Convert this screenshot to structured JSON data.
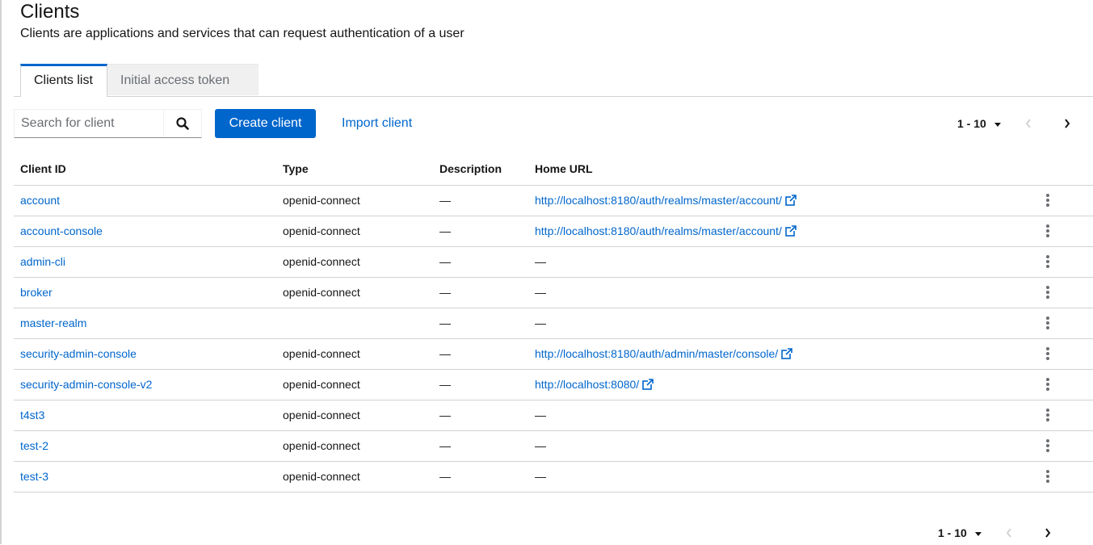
{
  "page": {
    "title": "Clients",
    "subtitle": "Clients are applications and services that can request authentication of a user"
  },
  "tabs": [
    {
      "label": "Clients list"
    },
    {
      "label": "Initial access token"
    }
  ],
  "toolbar": {
    "search_placeholder": "Search for client",
    "create_label": "Create client",
    "import_label": "Import client",
    "pagination": "1 - 10"
  },
  "table": {
    "headers": [
      "Client ID",
      "Type",
      "Description",
      "Home URL"
    ],
    "rows": [
      {
        "client_id": "account",
        "type": "openid-connect",
        "description": "—",
        "home_url": "http://localhost:8180/auth/realms/master/account/",
        "external": true
      },
      {
        "client_id": "account-console",
        "type": "openid-connect",
        "description": "—",
        "home_url": "http://localhost:8180/auth/realms/master/account/",
        "external": true
      },
      {
        "client_id": "admin-cli",
        "type": "openid-connect",
        "description": "—",
        "home_url": "—",
        "external": false
      },
      {
        "client_id": "broker",
        "type": "openid-connect",
        "description": "—",
        "home_url": "—",
        "external": false
      },
      {
        "client_id": "master-realm",
        "type": "",
        "description": "—",
        "home_url": "—",
        "external": false
      },
      {
        "client_id": "security-admin-console",
        "type": "openid-connect",
        "description": "—",
        "home_url": "http://localhost:8180/auth/admin/master/console/",
        "external": true
      },
      {
        "client_id": "security-admin-console-v2",
        "type": "openid-connect",
        "description": "—",
        "home_url": "http://localhost:8080/",
        "external": true
      },
      {
        "client_id": "t4st3",
        "type": "openid-connect",
        "description": "—",
        "home_url": "—",
        "external": false
      },
      {
        "client_id": "test-2",
        "type": "openid-connect",
        "description": "—",
        "home_url": "—",
        "external": false
      },
      {
        "client_id": "test-3",
        "type": "openid-connect",
        "description": "—",
        "home_url": "—",
        "external": false
      }
    ]
  },
  "footer": {
    "pagination": "1 - 10"
  },
  "colors": {
    "accent": "#0066cc",
    "text": "#151515",
    "muted": "#6a6e73",
    "border": "#d2d2d2"
  }
}
